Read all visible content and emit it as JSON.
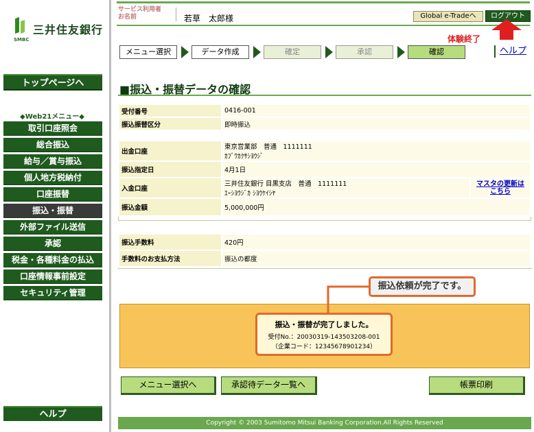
{
  "brand": {
    "name": "三井住友銀行",
    "sub": "SMBC"
  },
  "leftnav": {
    "top_button": "トップページへ",
    "menu_title": "◆Web21メニュー◆",
    "items": [
      {
        "label": "取引口座照会",
        "active": false
      },
      {
        "label": "総合振込",
        "active": false
      },
      {
        "label": "給与／賞与振込",
        "active": false
      },
      {
        "label": "個人地方税納付",
        "active": false
      },
      {
        "label": "口座振替",
        "active": false
      },
      {
        "label": "振込・振替",
        "active": true
      },
      {
        "label": "外部ファイル送信",
        "active": false
      },
      {
        "label": "承認",
        "active": false
      },
      {
        "label": "税金・各種料金の払込",
        "active": false
      },
      {
        "label": "口座情報事前設定",
        "active": false
      },
      {
        "label": "セキュリティ管理",
        "active": false
      }
    ],
    "help_button": "ヘルプ"
  },
  "header": {
    "user_label_1": "サービス利用者",
    "user_label_2": "お名前",
    "user_name": "若草　太郎様",
    "global_button": "Global e-Tradeへ",
    "logout_button": "ログアウト",
    "trial_end": "体験終了",
    "help_link": "ヘルプ"
  },
  "steps": [
    {
      "label": "メニュー選択",
      "state": "done"
    },
    {
      "label": "データ作成",
      "state": "done"
    },
    {
      "label": "確定",
      "state": "grey"
    },
    {
      "label": "承認",
      "state": "grey"
    },
    {
      "label": "確認",
      "state": "current"
    }
  ],
  "page_title": "■振込・振替データの確認",
  "receipt": {
    "rows": [
      {
        "label": "受付番号",
        "value": "0416-001"
      },
      {
        "label": "振込振替区分",
        "value": "即時振込"
      }
    ]
  },
  "transfer": {
    "from_label": "出金口座",
    "from_line1": "東京営業部　普通　1111111",
    "from_line2": "ｶﾌﾞﾜｶｸｻｼﾖｳｼﾞ",
    "date_label": "振込指定日",
    "date_value": "4月1日",
    "to_label": "入金口座",
    "to_line1": "三井住友銀行 目黒支店　普通　1111111",
    "to_line2": "ｴｰｼﾖｳｼﾞｶ ｼﾖｳｹｲｼﾔ",
    "master_update_1": "マスタの更新は",
    "master_update_2": "こちら",
    "amount_label": "振込金額",
    "amount_value": "5,000,000円"
  },
  "fees": {
    "rows": [
      {
        "label": "振込手数料",
        "value": "420円"
      },
      {
        "label": "手数料のお支払方法",
        "value": "振込の都度"
      }
    ]
  },
  "callout": "振込依頼が完了です。",
  "completion": {
    "title": "振込・振替が完了しました。",
    "receipt_no": "受付No.：20030319-143503208-001",
    "company_code": "（企業コード：12345678901234）"
  },
  "buttons": {
    "menu": "メニュー選択へ",
    "pending_list": "承認待データ一覧へ",
    "print": "帳票印刷"
  },
  "footer": "Copyright © 2003 Sumitomo Mitsui Banking Corporation.All Rights Reserved"
}
